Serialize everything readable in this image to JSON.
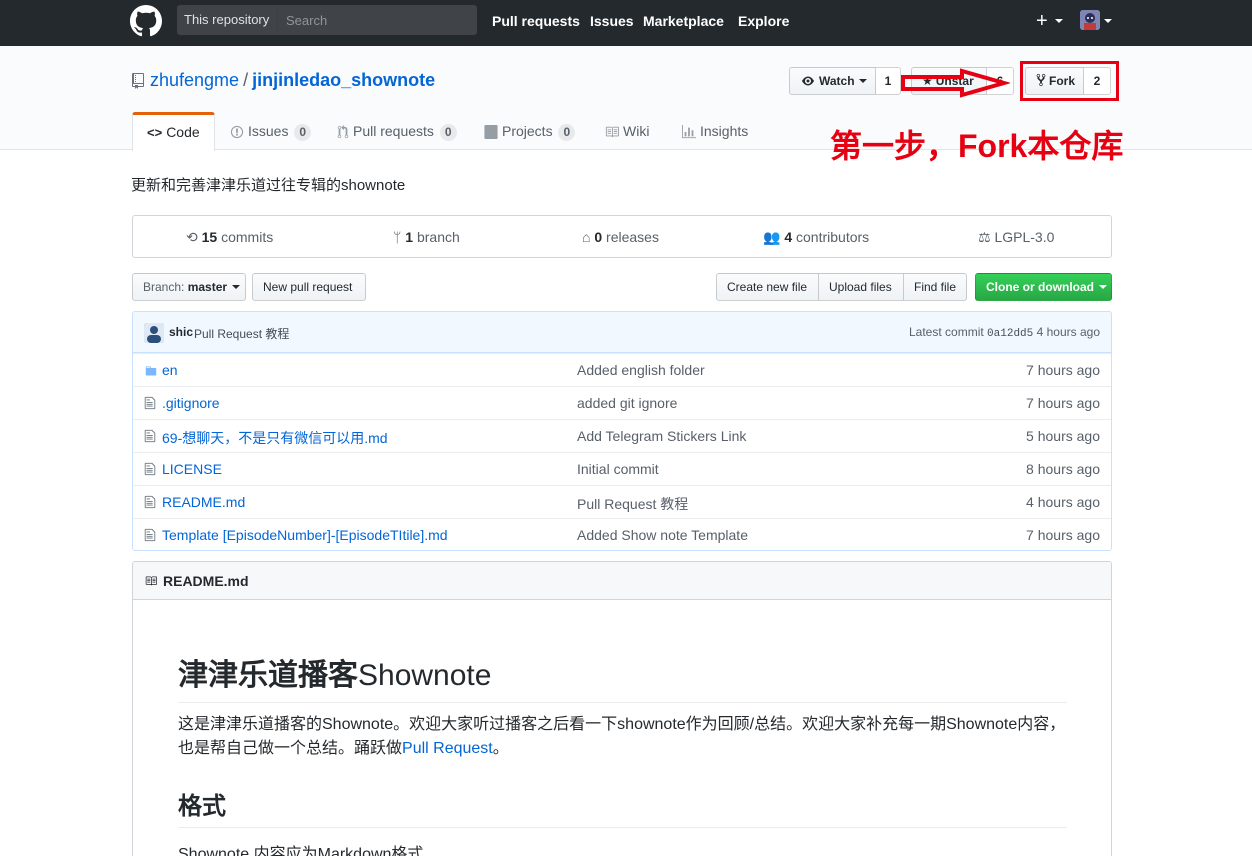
{
  "header": {
    "search_scope": "This repository",
    "search_placeholder": "Search",
    "nav": [
      "Pull requests",
      "Issues",
      "Marketplace",
      "Explore"
    ],
    "plus_label": "+"
  },
  "repo": {
    "owner": "zhufengme",
    "separator": "/",
    "name": "jinjinledao_shownote",
    "watch_label": "Watch",
    "watch_count": "1",
    "star_label": "Unstar",
    "star_count": "6",
    "fork_label": "Fork",
    "fork_count": "2"
  },
  "tabs": [
    {
      "label": "Code",
      "icon": "code-icon"
    },
    {
      "label": "Issues",
      "count": "0",
      "icon": "issue-icon"
    },
    {
      "label": "Pull requests",
      "count": "0",
      "icon": "pr-icon"
    },
    {
      "label": "Projects",
      "count": "0",
      "icon": "project-icon"
    },
    {
      "label": "Wiki",
      "icon": "book-icon"
    },
    {
      "label": "Insights",
      "icon": "graph-icon"
    }
  ],
  "description": "更新和完善津津乐道过往专辑的shownote",
  "summary": {
    "commits_num": "15",
    "commits_label": "commits",
    "branch_num": "1",
    "branch_label": "branch",
    "releases_num": "0",
    "releases_label": "releases",
    "contributors_num": "4",
    "contributors_label": "contributors",
    "license": "LGPL-3.0"
  },
  "filenav": {
    "branch_prefix": "Branch:",
    "branch_name": "master",
    "new_pr": "New pull request",
    "create_file": "Create new file",
    "upload": "Upload files",
    "find": "Find file",
    "clone": "Clone or download"
  },
  "commit": {
    "author": "shic",
    "message": "Pull Request 教程",
    "latest_label": "Latest commit",
    "sha": "0a12dd5",
    "age": "4 hours ago"
  },
  "files": [
    {
      "name": "en",
      "type": "folder",
      "message": "Added english folder",
      "age": "7 hours ago"
    },
    {
      "name": ".gitignore",
      "type": "file",
      "message": "added git ignore",
      "age": "7 hours ago"
    },
    {
      "name": "69-想聊天，不是只有微信可以用.md",
      "type": "file",
      "message": "Add Telegram Stickers Link",
      "age": "5 hours ago"
    },
    {
      "name": "LICENSE",
      "type": "file",
      "message": "Initial commit",
      "age": "8 hours ago"
    },
    {
      "name": "README.md",
      "type": "file",
      "message": "Pull Request 教程",
      "age": "4 hours ago"
    },
    {
      "name": "Template [EpisodeNumber]-[EpisodeTItile].md",
      "type": "file",
      "message": "Added Show note Template",
      "age": "7 hours ago"
    }
  ],
  "readme": {
    "filename": "README.md",
    "h1_cn": "津津乐道播客",
    "h1_en": "Shownote",
    "p1": "这是津津乐道播客的Shownote。欢迎大家听过播客之后看一下shownote作为回顾/总结。欢迎大家补充每一期Shownote内容，也是帮自己做一个总结。踊跃做",
    "p1_link": "Pull Request",
    "p1_end": "。",
    "h2": "格式",
    "p2": "Shownote 内容应为Markdown格式"
  },
  "annotation": {
    "text": "第一步，Fork本仓库",
    "color": "#e60012"
  }
}
